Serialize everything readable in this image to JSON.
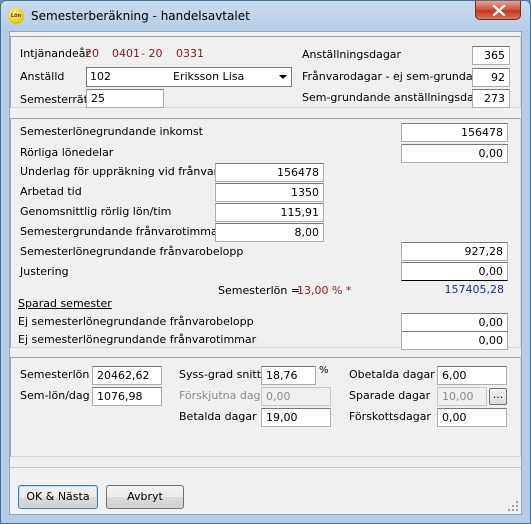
{
  "window": {
    "title": "Semesterberäkning - handelsavtalet",
    "icon_name": "lon-app-icon",
    "icon_text": "Lön"
  },
  "header": {
    "intjanandear_label": "Intjänandeår",
    "period_start_prefix": "20",
    "period_start_suffix": "0401",
    "period_sep": "- 20",
    "period_end_suffix": "0331",
    "anstalld_label": "Anställd",
    "employee_code": "102",
    "employee_name": "Eriksson Lisa",
    "semesterratt_label": "Semesterrätt",
    "semesterratt_value": "25",
    "anstallningsdagar_label": "Anställningsdagar",
    "anstallningsdagar_value": "365",
    "franvarodagar_label": "Frånvarodagar - ej sem-grundande",
    "franvarodagar_value": "92",
    "semgrundande_label": "Sem-grundande anställningsdagar",
    "semgrundande_value": "273"
  },
  "calc": {
    "semesterlonegrundande_inkomst_label": "Semesterlönegrundande inkomst",
    "semesterlonegrundande_inkomst_value": "156478",
    "rorliga_lonedelar_label": "Rörliga lönedelar",
    "rorliga_lonedelar_value": "0,00",
    "underlag_label": "Underlag för uppräkning vid frånvaro",
    "underlag_value": "156478",
    "arbetad_tid_label": "Arbetad tid",
    "arbetad_tid_value": "1350",
    "genomsnittlig_label": "Genomsnittlig rörlig lön/tim",
    "genomsnittlig_value": "115,91",
    "semestergrundande_timmar_label": "Semestergrundande frånvarotimmar",
    "semestergrundande_timmar_value": "8,00",
    "franvarobelopp_label": "Semesterlönegrundande frånvarobelopp",
    "franvarobelopp_value": "927,28",
    "justering_label": "Justering",
    "justering_value": "0,00",
    "semesterlon_label": "Semesterlön  =",
    "semesterlon_percent": "13,00 %  *",
    "semesterlon_value": "157405,28",
    "sparad_semester_label": "Sparad semester",
    "ej_belopp_label": "Ej semesterlönegrundande frånvarobelopp",
    "ej_belopp_value": "0,00",
    "ej_timmar_label": "Ej semesterlönegrundande frånvarotimmar",
    "ej_timmar_value": "0,00"
  },
  "summary": {
    "semesterlon_label": "Semesterlön",
    "semesterlon_value": "20462,62",
    "semlon_dag_label": "Sem-lön/dag",
    "semlon_dag_value": "1076,98",
    "syss_grad_label": "Syss-grad snitt",
    "syss_grad_value": "18,76",
    "percent_sign": "%",
    "forskjutna_label": "Förskjutna dagar",
    "forskjutna_value": "0,00",
    "betalda_label": "Betalda dagar",
    "betalda_value": "19,00",
    "obetalda_label": "Obetalda dagar",
    "obetalda_value": "6,00",
    "sparade_label": "Sparade dagar",
    "sparade_value": "10,00",
    "browse_label": "...",
    "forskott_label": "Förskottsdagar",
    "forskott_value": "0,00"
  },
  "buttons": {
    "ok_label": "OK & Nästa",
    "cancel_label": "Avbryt"
  },
  "colors": {
    "accent_red": "#8b1a1a",
    "accent_blue": "#1a2e9c",
    "close_button": "#c2391f"
  }
}
